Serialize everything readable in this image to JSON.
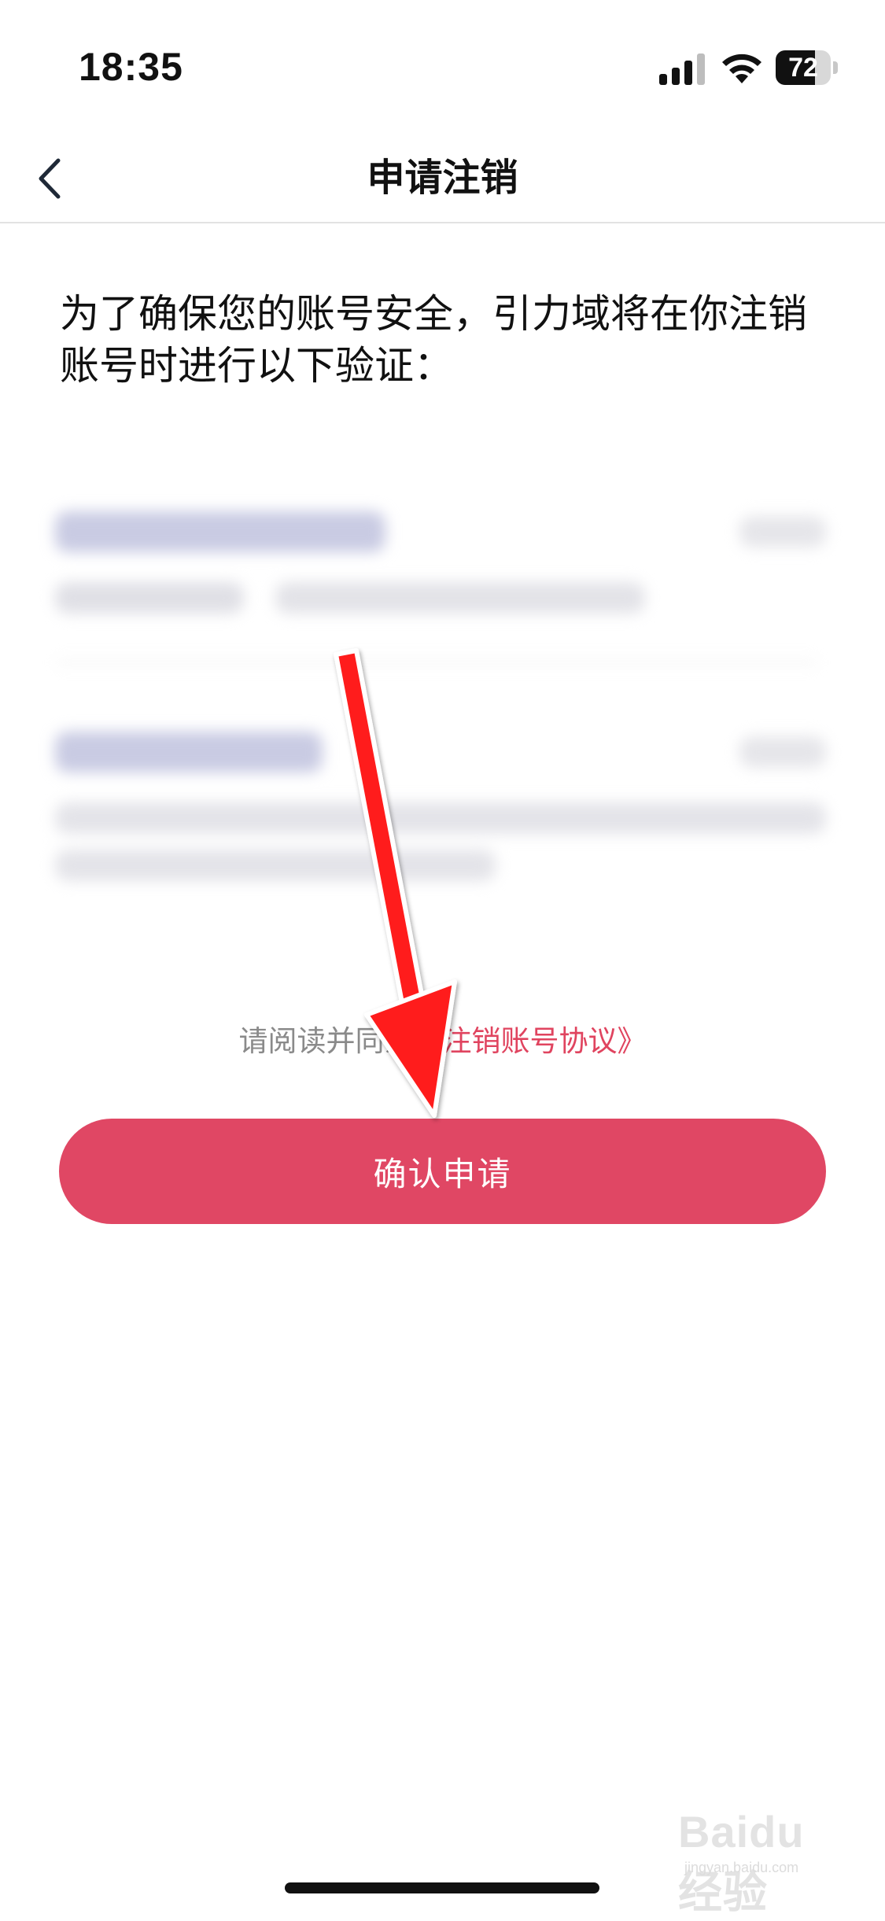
{
  "status_bar": {
    "time": "18:35",
    "battery_level": "72",
    "battery_fraction": 0.72,
    "icons": [
      "signal-icon",
      "wifi-icon",
      "battery-icon"
    ]
  },
  "nav": {
    "title": "申请注销",
    "back_icon": "chevron-left-icon"
  },
  "intro": {
    "text": "为了确保您的账号安全，引力域将在你注销账号时进行以下验证："
  },
  "agreement": {
    "prefix": "请阅读并同意",
    "link_text": "《注销账号协议》"
  },
  "confirm_button": {
    "label": "确认申请"
  },
  "watermark": {
    "main": "Baidu经验",
    "sub": "jingyan.baidu.com"
  },
  "colors": {
    "accent": "#e04764",
    "link": "#e0445f",
    "annotation_arrow": "#ff1a1a"
  }
}
